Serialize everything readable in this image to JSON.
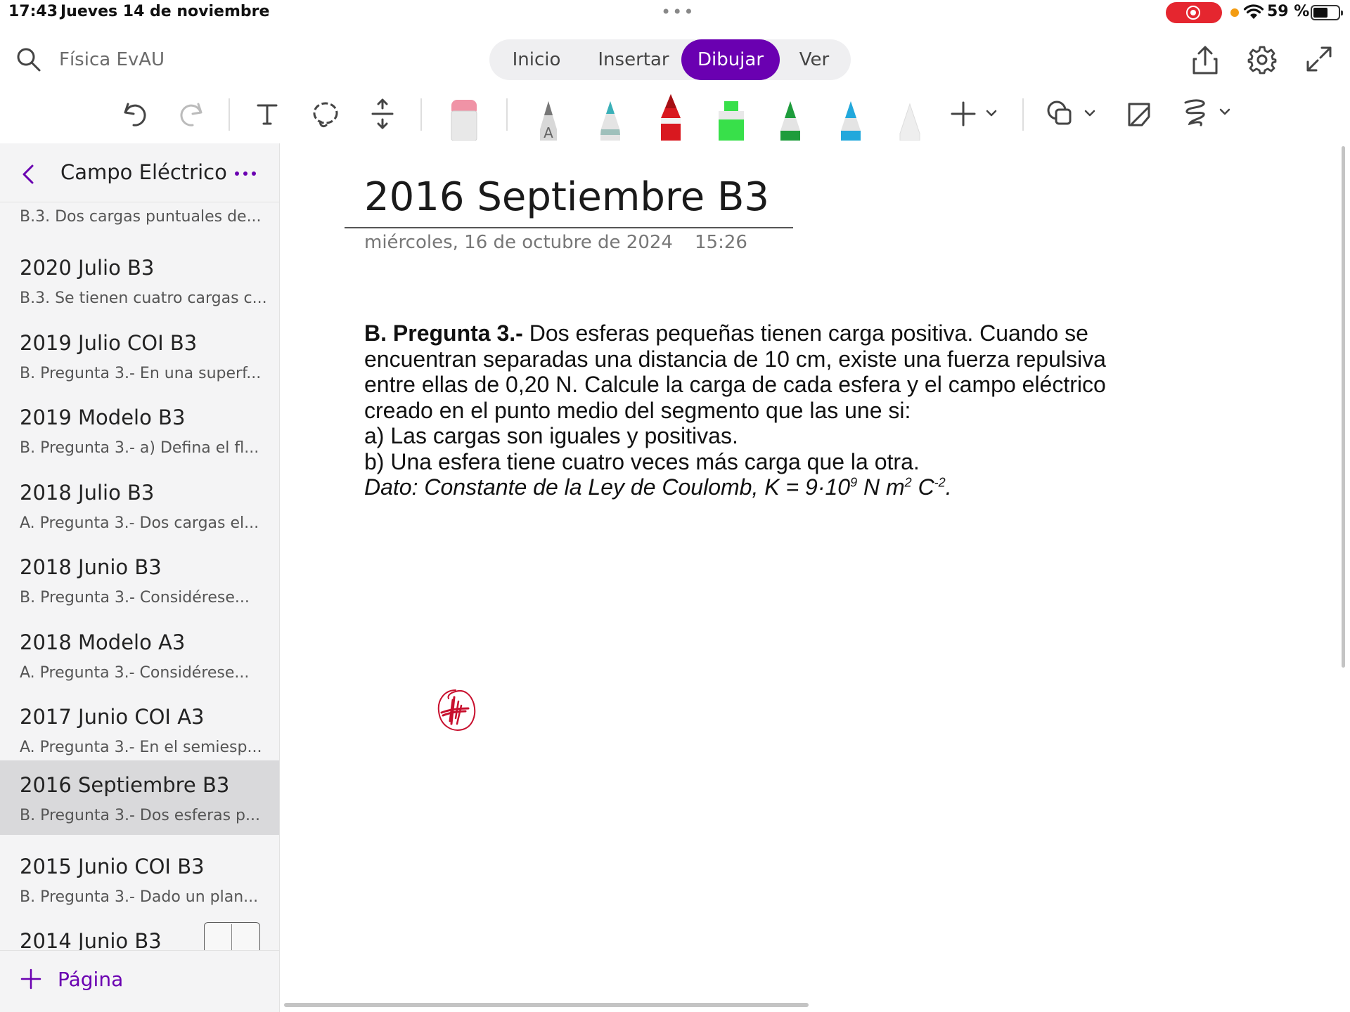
{
  "status_bar": {
    "time": "17:43",
    "date": "Jueves 14 de noviembre",
    "battery": "59 %",
    "battery_level": 0.59,
    "recording_color": "#e5262f"
  },
  "toolbar": {
    "notebook_name": "Física EvAU",
    "tabs": [
      {
        "label": "Inicio",
        "active": false
      },
      {
        "label": "Insertar",
        "active": false
      },
      {
        "label": "Dibujar",
        "active": true
      },
      {
        "label": "Ver",
        "active": false
      }
    ],
    "accent_color": "#6a00b1"
  },
  "ribbon": {
    "tools": [
      "undo-icon",
      "redo-icon",
      "text-icon",
      "lasso-icon",
      "space-icon",
      "eraser-icon",
      "pencil-grey",
      "pen-teal",
      "pen-red",
      "highlighter-green",
      "pen-green",
      "pen-blue",
      "pen-white",
      "add-pen-icon",
      "shapes-icon",
      "ink-to-shape-icon",
      "ink-tools-icon"
    ],
    "pen_colors": [
      "#8a8a8a",
      "#3ab0b8",
      "#d9181f",
      "#38e04a",
      "#1e9c3c",
      "#22a8dc",
      "#f0f0f0"
    ]
  },
  "sidebar": {
    "section_title": "Campo Eléctrico",
    "first_snippet": "B.3. Dos cargas puntuales de...",
    "pages": [
      {
        "title": "2020 Julio B3",
        "snippet": "B.3. Se tienen cuatro cargas c..."
      },
      {
        "title": "2019 Julio COI B3",
        "snippet": "B. Pregunta 3.- En una superf..."
      },
      {
        "title": "2019 Modelo B3",
        "snippet": "B. Pregunta 3.- a) Defina el fl..."
      },
      {
        "title": "2018 Julio B3",
        "snippet": "A. Pregunta 3.- Dos cargas el..."
      },
      {
        "title": "2018 Junio B3",
        "snippet": "B. Pregunta 3.- Considérese..."
      },
      {
        "title": "2018 Modelo A3",
        "snippet": "A. Pregunta 3.- Considérese..."
      },
      {
        "title": "2017 Junio COI A3",
        "snippet": "A. Pregunta 3.- En el semiesp..."
      },
      {
        "title": "2016 Septiembre B3",
        "snippet": "B. Pregunta 3.- Dos esferas p...",
        "selected": true
      },
      {
        "title": "2015 Junio COI B3",
        "snippet": "B. Pregunta 3.- Dado un plan..."
      },
      {
        "title": "2014 Junio B3",
        "snippet": ""
      }
    ],
    "add_page_label": "Página"
  },
  "page": {
    "title": "2016 Septiembre B3",
    "date": "miércoles, 16 de octubre de 2024",
    "time": "15:26",
    "question_label": "B. Pregunta 3.-",
    "question_text": " Dos esferas pequeñas tienen carga positiva. Cuando se encuentran separadas una distancia de 10 cm, existe una fuerza repulsiva entre ellas de 0,20 N. Calcule la carga de cada esfera y el campo eléctrico creado en el punto medio del segmento que las une si:",
    "part_a": "a) Las cargas son iguales y positivas.",
    "part_b": "b) Una esfera tiene cuatro veces más carga que la otra.",
    "dato_prefix": "Dato: Constante de la Ley de Coulomb, K = 9·10",
    "dato_exp1": "9",
    "dato_mid": " N m",
    "dato_exp2": "2",
    "dato_c": " C",
    "dato_exp3": "-2",
    "dato_end": ".",
    "ink_color": "#c8102e"
  }
}
